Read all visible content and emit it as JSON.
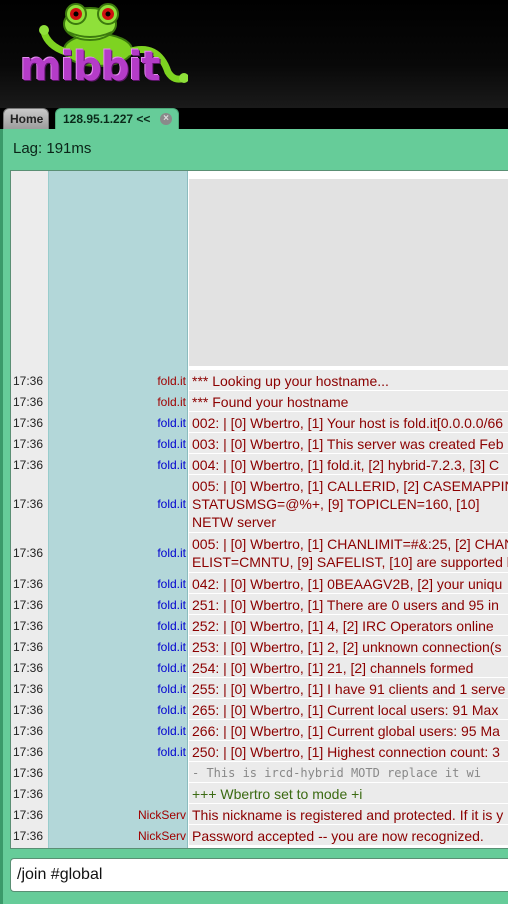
{
  "brand": {
    "logo_text": "mibbit"
  },
  "tabs": [
    {
      "label": "Home"
    },
    {
      "label": "128.95.1.227 <<",
      "close_icon": "close-icon"
    }
  ],
  "status": {
    "lag": "Lag: 191ms"
  },
  "messages": [
    {
      "time": "17:36",
      "nick": "fold.it",
      "text": "*** Looking up your hostname..."
    },
    {
      "time": "17:36",
      "nick": "fold.it",
      "text": "*** Found your hostname"
    },
    {
      "time": "17:36",
      "nick": "fold.it",
      "text": "002:  | [0] Wbertro, [1] Your host is fold.it[0.0.0.0/66"
    },
    {
      "time": "17:36",
      "nick": "fold.it",
      "text": "003:  | [0] Wbertro, [1] This server was created Feb"
    },
    {
      "time": "17:36",
      "nick": "fold.it",
      "text": "004:  | [0] Wbertro, [1] fold.it, [2] hybrid-7.2.3, [3] C"
    },
    {
      "time": "17:36",
      "nick": "fold.it",
      "text": "005:  | [0] Wbertro, [1] CALLERID, [2] CASEMAPPIN STATUSMSG=@%+, [9] TOPICLEN=160, [10] NETW server"
    },
    {
      "time": "17:36",
      "nick": "fold.it",
      "text": "005:  | [0] Wbertro, [1] CHANLIMIT=#&:25, [2] CHAN ELIST=CMNTU, [9] SAFELIST, [10] are supported b"
    },
    {
      "time": "17:36",
      "nick": "fold.it",
      "text": "042:  | [0] Wbertro, [1] 0BEAAGV2B, [2] your uniqu"
    },
    {
      "time": "17:36",
      "nick": "fold.it",
      "text": "251:  | [0] Wbertro, [1] There are 0 users and 95 in"
    },
    {
      "time": "17:36",
      "nick": "fold.it",
      "text": "252:  | [0] Wbertro, [1] 4, [2] IRC Operators online"
    },
    {
      "time": "17:36",
      "nick": "fold.it",
      "text": "253:  | [0] Wbertro, [1] 2, [2] unknown connection(s"
    },
    {
      "time": "17:36",
      "nick": "fold.it",
      "text": "254:  | [0] Wbertro, [1] 21, [2] channels formed"
    },
    {
      "time": "17:36",
      "nick": "fold.it",
      "text": "255:  | [0] Wbertro, [1] I have 91 clients and 1 serve"
    },
    {
      "time": "17:36",
      "nick": "fold.it",
      "text": "265:  | [0] Wbertro, [1] Current local users: 91  Max"
    },
    {
      "time": "17:36",
      "nick": "fold.it",
      "text": "266:  | [0] Wbertro, [1] Current global users: 95  Ma"
    },
    {
      "time": "17:36",
      "nick": "fold.it",
      "text": "250:  | [0] Wbertro, [1] Highest connection count: 3"
    },
    {
      "time": "17:36",
      "nick": "",
      "text": "- This is ircd-hybrid MOTD replace it wi"
    },
    {
      "time": "17:36",
      "nick": "",
      "text": "+++ Wbertro set to mode +i"
    },
    {
      "time": "17:36",
      "nick": "NickServ",
      "text": "This nickname is registered and protected.  If it is y"
    },
    {
      "time": "17:36",
      "nick": "NickServ",
      "text": "Password accepted -- you are now recognized."
    }
  ],
  "input": {
    "value": "/join #global"
  },
  "colors": {
    "panel": "#66cc99",
    "nick_column": "#b3d7d9",
    "message_red": "#8b0000",
    "nick_blue": "#0000d0",
    "nick_red": "#a00000",
    "mode_green": "#3b6a12"
  }
}
